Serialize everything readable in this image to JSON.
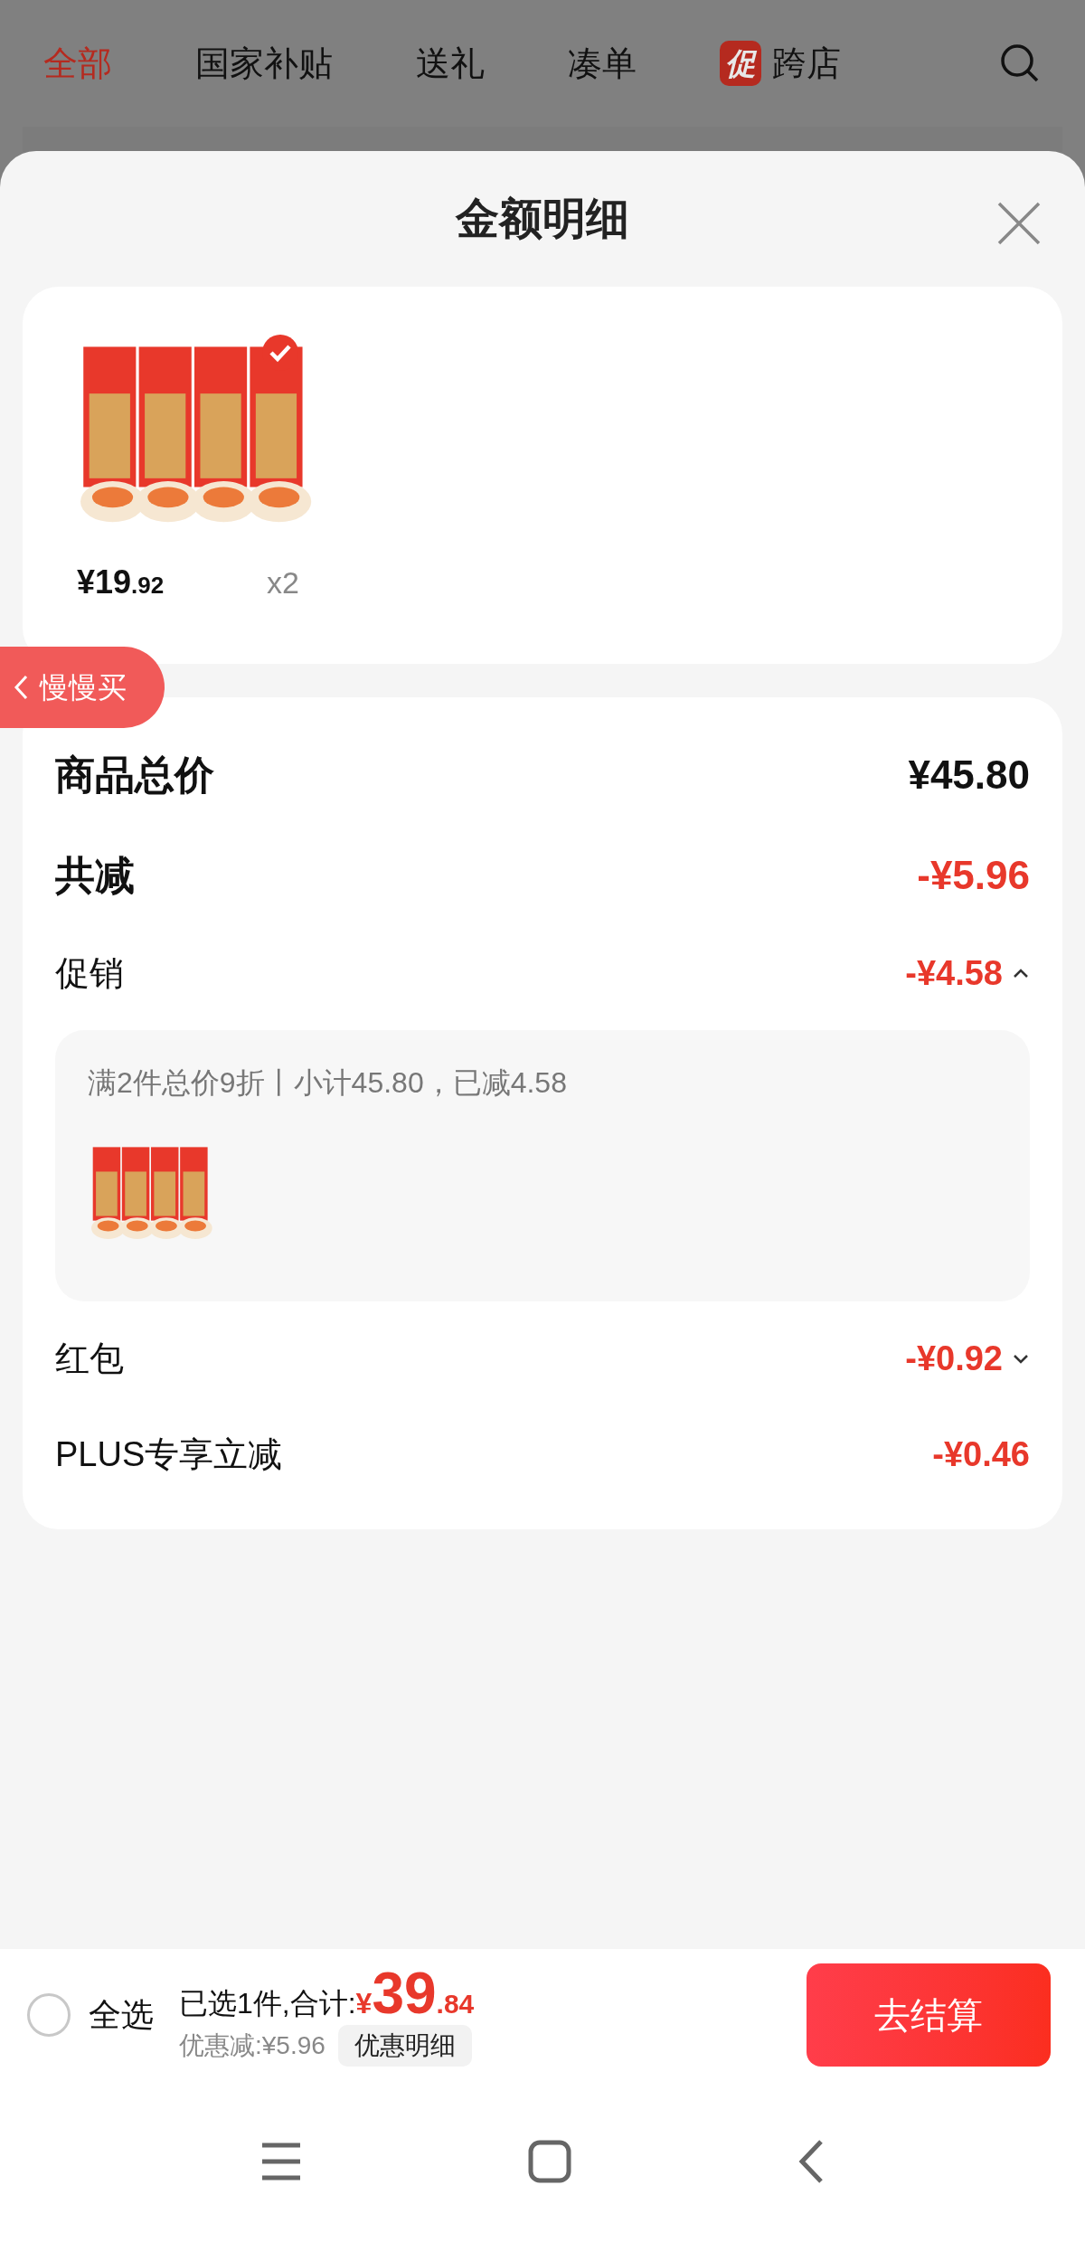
{
  "top_tabs": [
    {
      "label": "全部",
      "selected": true
    },
    {
      "label": "国家补贴",
      "selected": false
    },
    {
      "label": "送礼",
      "selected": false
    },
    {
      "label": "凑单",
      "selected": false
    },
    {
      "label": "跨店",
      "selected": false,
      "badge": "促"
    }
  ],
  "sheet": {
    "title": "金额明细"
  },
  "product": {
    "price": "¥19",
    "price_decimal": ".92",
    "quantity": "x2",
    "checked": true
  },
  "side_tab": {
    "label": "慢慢买"
  },
  "summary": [
    {
      "kind": "major",
      "label": "商品总价",
      "amount": "¥45.80",
      "highlight": false
    },
    {
      "kind": "major",
      "label": "共减",
      "amount": "-¥5.96",
      "highlight": true
    },
    {
      "kind": "minor",
      "label": "促销",
      "amount": "-¥4.58",
      "highlight": true,
      "expanded": true,
      "detail": {
        "text": "满2件总价9折丨小计45.80，已减4.58"
      }
    },
    {
      "kind": "minor",
      "label": "红包",
      "amount": "-¥0.92",
      "highlight": true,
      "expanded": false
    },
    {
      "kind": "minor",
      "label": "PLUS专享立减",
      "amount": "-¥0.46",
      "highlight": true
    }
  ],
  "bottom_bar": {
    "select_all": {
      "label": "全选",
      "checked": false
    },
    "selected_text": "已选1件,合计:",
    "currency": "¥",
    "total": "39",
    "total_decimal": ".84",
    "discount": "优惠减:¥5.96",
    "details_button": "优惠明细",
    "checkout": "去结算"
  }
}
